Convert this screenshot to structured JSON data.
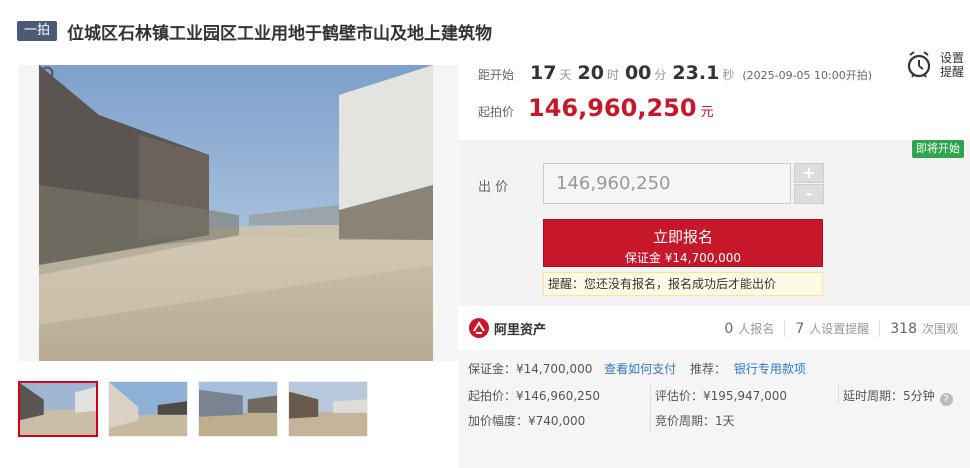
{
  "header": {
    "badge": "一拍",
    "title": "位城区石林镇工业园区工业用地于鹤壁市山及地上建筑物"
  },
  "countdown": {
    "label": "距开始",
    "days": "17",
    "days_unit": "天",
    "hours": "20",
    "hours_unit": "时",
    "minutes": "00",
    "minutes_unit": "分",
    "seconds": "23.1",
    "seconds_unit": "秒",
    "start_note": "(2025-09-05 10:00开拍)"
  },
  "remind": {
    "label": "设置提醒",
    "icon": "alarm-clock-icon"
  },
  "start_price": {
    "label": "起拍价",
    "value": "146,960,250",
    "unit": "元"
  },
  "bid": {
    "status_tag": "即将开始",
    "label": "出  价",
    "value": "146,960,250",
    "plus": "+",
    "minus": "-",
    "signup_label": "立即报名",
    "deposit_text": "保证金 ¥14,700,000",
    "notice": "提醒：您还没有报名，报名成功后才能出价"
  },
  "stats": {
    "platform": "阿里资产",
    "signups": "0",
    "signups_label": "人报名",
    "reminders": "7",
    "reminders_label": "人设置提醒",
    "views": "318",
    "views_label": "次围观"
  },
  "details": {
    "deposit": "保证金：¥14,700,000",
    "how_to_pay": "查看如何支付",
    "recommend": "推荐：",
    "dedicated_account": "银行专用款项",
    "start_price": "起拍价：¥146,960,250",
    "assessed": "评估价：¥195,947,000",
    "extension": "延时周期：5分钟",
    "increment": "加价幅度：¥740,000",
    "bid_cycle": "竞价周期：1天"
  },
  "colors": {
    "accent_red": "#c7182b",
    "badge_blue": "#4a5a78",
    "link_blue": "#3478c6",
    "status_green": "#2ea44f"
  }
}
